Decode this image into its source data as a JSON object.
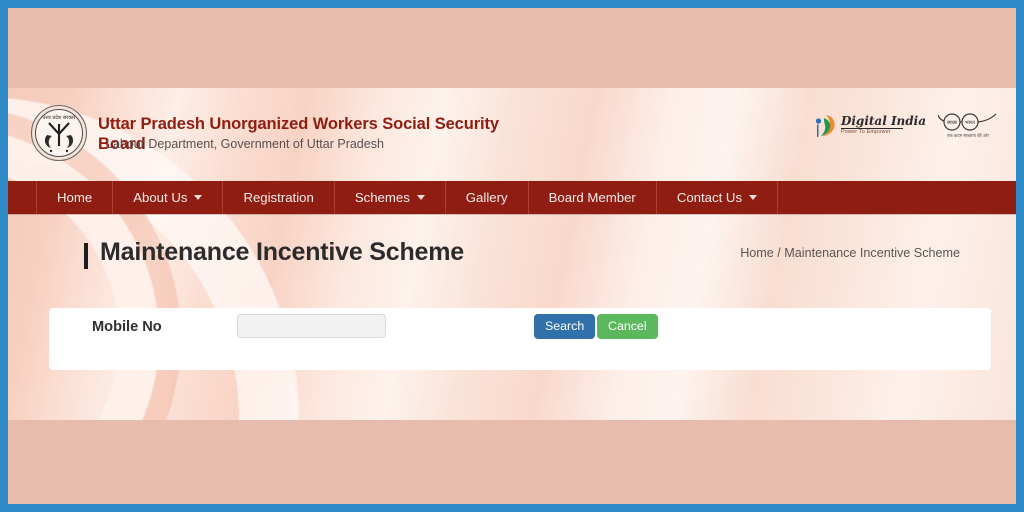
{
  "colors": {
    "frame_border": "#2e8bc8",
    "page_background": "#e8bcac",
    "nav_background": "#8f1d11",
    "brand_text": "#8f1d11",
    "search_button": "#3071a9",
    "cancel_button": "#5cb85c",
    "card_background": "#ffffff",
    "input_background": "#f2f2f2"
  },
  "header": {
    "emblem_icon": "uttar-pradesh-government-emblem-icon",
    "org_title": "Uttar Pradesh Unorganized Workers Social Security",
    "org_title_second_line": "Board",
    "org_subtitle": "Labour Department, Government of Uttar Pradesh",
    "logos": {
      "digital_india_name": "Digital India",
      "digital_india_tagline": "Power To Empower",
      "digital_india_icon": "digital-india-logo-icon",
      "swachh_bharat_icon": "swachh-bharat-glasses-icon",
      "swachh_bharat_left_text": "स्वच्छ",
      "swachh_bharat_right_text": "भारत",
      "swachh_bharat_tagline": "एक कदम स्वच्छता की ओर"
    }
  },
  "nav": {
    "items": [
      {
        "label": "Home",
        "has_dropdown": false
      },
      {
        "label": "About Us",
        "has_dropdown": true
      },
      {
        "label": "Registration",
        "has_dropdown": false
      },
      {
        "label": "Schemes",
        "has_dropdown": true
      },
      {
        "label": "Gallery",
        "has_dropdown": false
      },
      {
        "label": "Board Member",
        "has_dropdown": false
      },
      {
        "label": "Contact Us",
        "has_dropdown": true
      }
    ]
  },
  "page": {
    "title": "Maintenance Incentive Scheme",
    "breadcrumb": {
      "home": "Home",
      "separator": " / ",
      "current": "Maintenance Incentive Scheme"
    }
  },
  "form": {
    "mobile_label": "Mobile No",
    "mobile_value": "",
    "mobile_placeholder": "",
    "search_label": "Search",
    "cancel_label": "Cancel"
  }
}
